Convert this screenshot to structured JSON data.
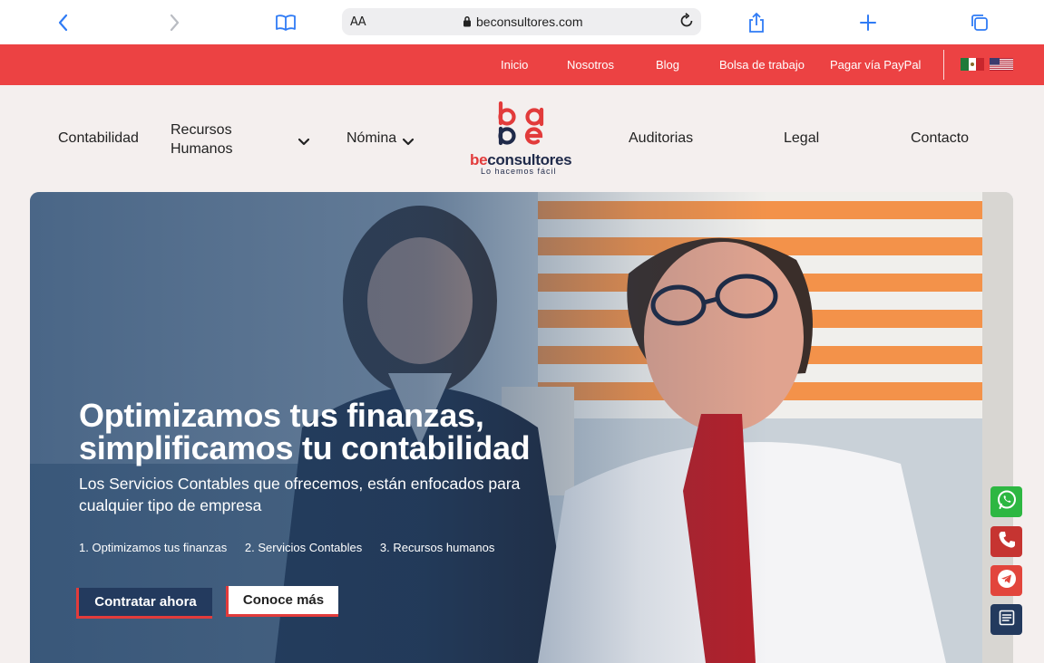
{
  "browser": {
    "url": "beconsultores.com",
    "text_size_label": "AA"
  },
  "topbar": {
    "links": [
      "Inicio",
      "Nosotros",
      "Blog",
      "Bolsa de trabajo",
      "Pagar vía PayPal"
    ]
  },
  "nav": {
    "items": [
      "Contabilidad",
      "Recursos Humanos",
      "Nómina",
      "Auditorias",
      "Legal",
      "Contacto"
    ],
    "logo": {
      "brand_prefix": "be",
      "brand_suffix": "consultores",
      "tagline": "Lo hacemos fácil"
    }
  },
  "hero": {
    "title": "Optimizamos tus finanzas, simplificamos tu contabilidad",
    "subtitle": "Los Servicios Contables que ofrecemos, están enfocados para cualquier tipo de empresa",
    "steps": [
      "1. Optimizamos tus finanzas",
      "2. Servicios Contables",
      "3. Recursos humanos"
    ],
    "primary_button": "Contratar ahora",
    "secondary_button": "Conoce más"
  },
  "colors": {
    "brand_red": "#ec4243",
    "brand_navy": "#233a5e",
    "whatsapp_green": "#2db742",
    "telegram_red": "#e2453c"
  },
  "floating_actions": [
    "whatsapp-icon",
    "phone-icon",
    "telegram-icon",
    "form-icon"
  ]
}
